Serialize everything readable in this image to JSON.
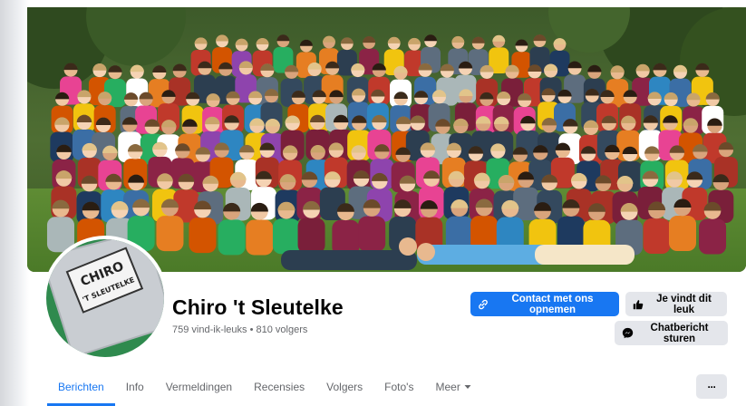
{
  "page": {
    "name": "Chiro 't Sleutelke",
    "stats": "759 vind-ik-leuks • 810 volgers"
  },
  "buttons": {
    "contact": "Contact met ons opnemen",
    "like": "Je vindt dit leuk",
    "message": "Chatbericht sturen"
  },
  "tabs": [
    {
      "label": "Berichten",
      "active": true
    },
    {
      "label": "Info"
    },
    {
      "label": "Vermeldingen"
    },
    {
      "label": "Recensies"
    },
    {
      "label": "Volgers"
    },
    {
      "label": "Foto's"
    },
    {
      "label": "Meer"
    }
  ],
  "more_button": "···",
  "avatar": {
    "badge_text_line1": "CHIRO",
    "badge_text_line2": "'T SLEUTELKE"
  },
  "icons": {
    "contact": "link-icon",
    "like": "thumbs-up-icon",
    "message": "messenger-icon",
    "more_tab": "caret-down-icon",
    "more_button": "ellipsis-icon"
  },
  "colors": {
    "accent": "#1877f2",
    "secondary_button": "#e4e6eb",
    "text_primary": "#050505",
    "text_secondary": "#65676b"
  }
}
